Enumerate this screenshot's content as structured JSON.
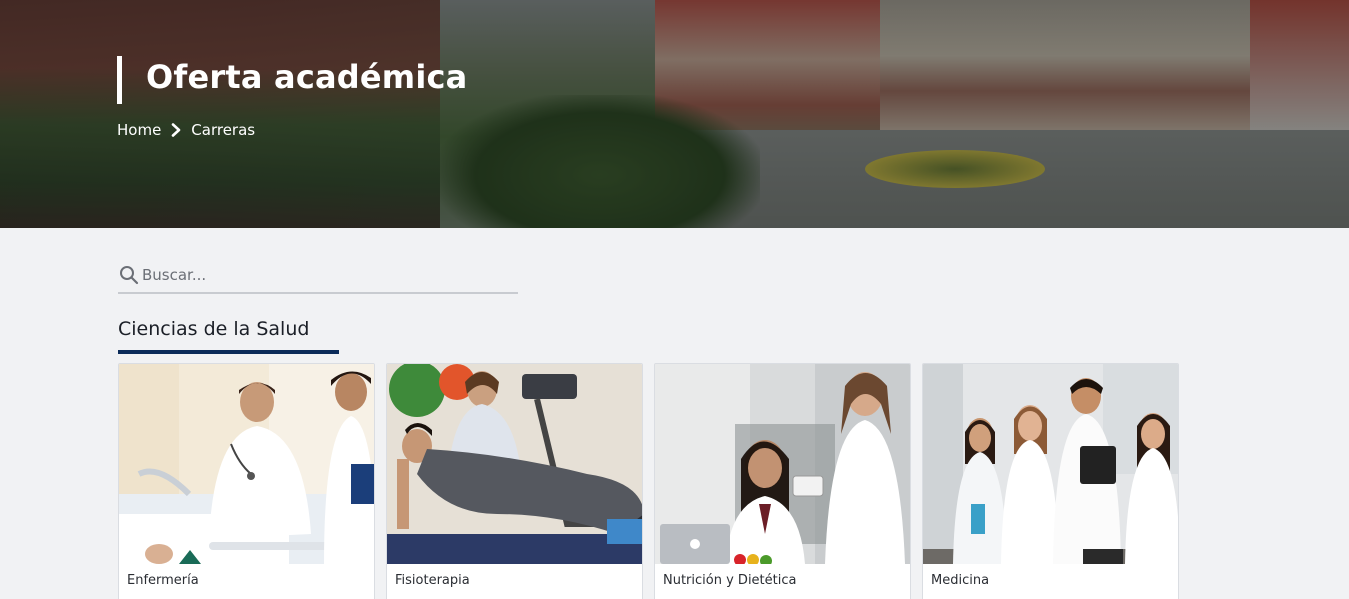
{
  "hero": {
    "title": "Oferta académica",
    "breadcrumb": [
      {
        "label": "Home"
      },
      {
        "label": "Carreras"
      }
    ]
  },
  "search": {
    "placeholder": "Buscar..."
  },
  "section": {
    "title": "Ciencias de la Salud",
    "accent_color": "#0b2b59"
  },
  "cards": [
    {
      "label": "Enfermería",
      "image": "nurses-with-patient-photo"
    },
    {
      "label": "Fisioterapia",
      "image": "physiotherapy-session-photo"
    },
    {
      "label": "Nutrición y Dietética",
      "image": "nutrition-students-photo"
    },
    {
      "label": "Medicina",
      "image": "medicine-students-photo"
    }
  ]
}
